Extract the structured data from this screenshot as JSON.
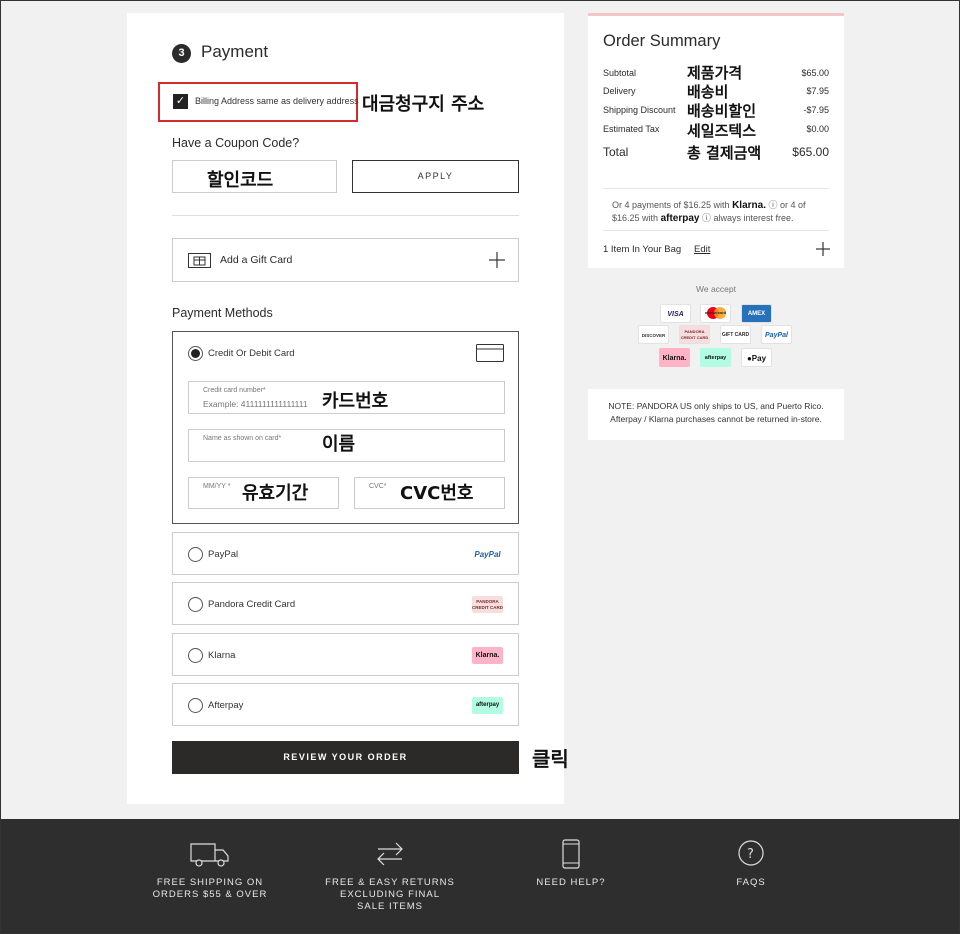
{
  "payment": {
    "step_number": "3",
    "title": "Payment",
    "billing_same_label": "Billing Address same as delivery address",
    "billing_annotation": "대금청구지 주소",
    "coupon_title": "Have a Coupon Code?",
    "coupon_annotation": "할인코드",
    "apply_label": "APPLY",
    "gift_card_label": "Add a Gift Card",
    "methods_title": "Payment Methods",
    "card_method_label": "Credit Or Debit Card",
    "card_number_label": "Credit card number*",
    "card_number_placeholder": "Example: 4111111111111111",
    "card_number_annotation": "카드번호",
    "name_label": "Name as shown on card*",
    "name_annotation": "이름",
    "expiry_label": "MM/YY *",
    "expiry_annotation": "유효기간",
    "cvc_label": "CVC*",
    "cvc_annotation": "CVC번호",
    "other_methods": [
      {
        "label": "PayPal",
        "badge": "PayPal"
      },
      {
        "label": "Pandora Credit Card",
        "badge": "PANDORA CREDIT CARD"
      },
      {
        "label": "Klarna",
        "badge": "Klarna."
      },
      {
        "label": "Afterpay",
        "badge": "afterpay"
      }
    ],
    "review_button": "REVIEW YOUR ORDER",
    "review_annotation": "클릭"
  },
  "summary": {
    "title": "Order Summary",
    "rows": [
      {
        "label": "Subtotal",
        "annotation": "제품가격",
        "value": "$65.00"
      },
      {
        "label": "Delivery",
        "annotation": "배송비",
        "value": "$7.95"
      },
      {
        "label": "Shipping Discount",
        "annotation": "배송비할인",
        "value": "-$7.95"
      },
      {
        "label": "Estimated Tax",
        "annotation": "세일즈텍스",
        "value": "$0.00"
      }
    ],
    "total_label": "Total",
    "total_annotation": "총 결제금액",
    "total_value": "$65.00",
    "installments_line1": "Or 4 payments of $16.25 with",
    "klarna_word": "Klarna.",
    "installments_or": "or 4 of",
    "installments_line2": "$16.25 with",
    "afterpay_word": "afterpay",
    "interest_free": "always interest free.",
    "bag_label": "1 Item In Your Bag",
    "edit_label": "Edit"
  },
  "accept": {
    "title": "We accept",
    "logos": [
      "VISA",
      "mastercard",
      "AMEX",
      "DISCOVER",
      "PANDORA CREDIT CARD",
      "GIFT CARD",
      "PayPal",
      "Klarna.",
      "afterpay",
      "Pay"
    ]
  },
  "note": {
    "line1": "NOTE: PANDORA US only ships to US, and Puerto Rico.",
    "line2": "Afterpay / Klarna purchases cannot be returned in-store."
  },
  "footer": {
    "items": [
      {
        "line1": "FREE SHIPPING ON",
        "line2": "ORDERS $55 & OVER",
        "line3": ""
      },
      {
        "line1": "FREE & EASY RETURNS",
        "line2": "EXCLUDING FINAL",
        "line3": "SALE ITEMS"
      },
      {
        "line1": "NEED HELP?",
        "line2": "",
        "line3": ""
      },
      {
        "line1": "FAQS",
        "line2": "",
        "line3": ""
      }
    ]
  },
  "colors": {
    "highlight_border": "#d62b2b",
    "primary_dark": "#2c2a29",
    "footer_bg": "#2e2e2e",
    "summary_top_accent": "#f2c6c6",
    "klarna_pink": "#ffb3c7",
    "afterpay_mint": "#b2fce4"
  }
}
